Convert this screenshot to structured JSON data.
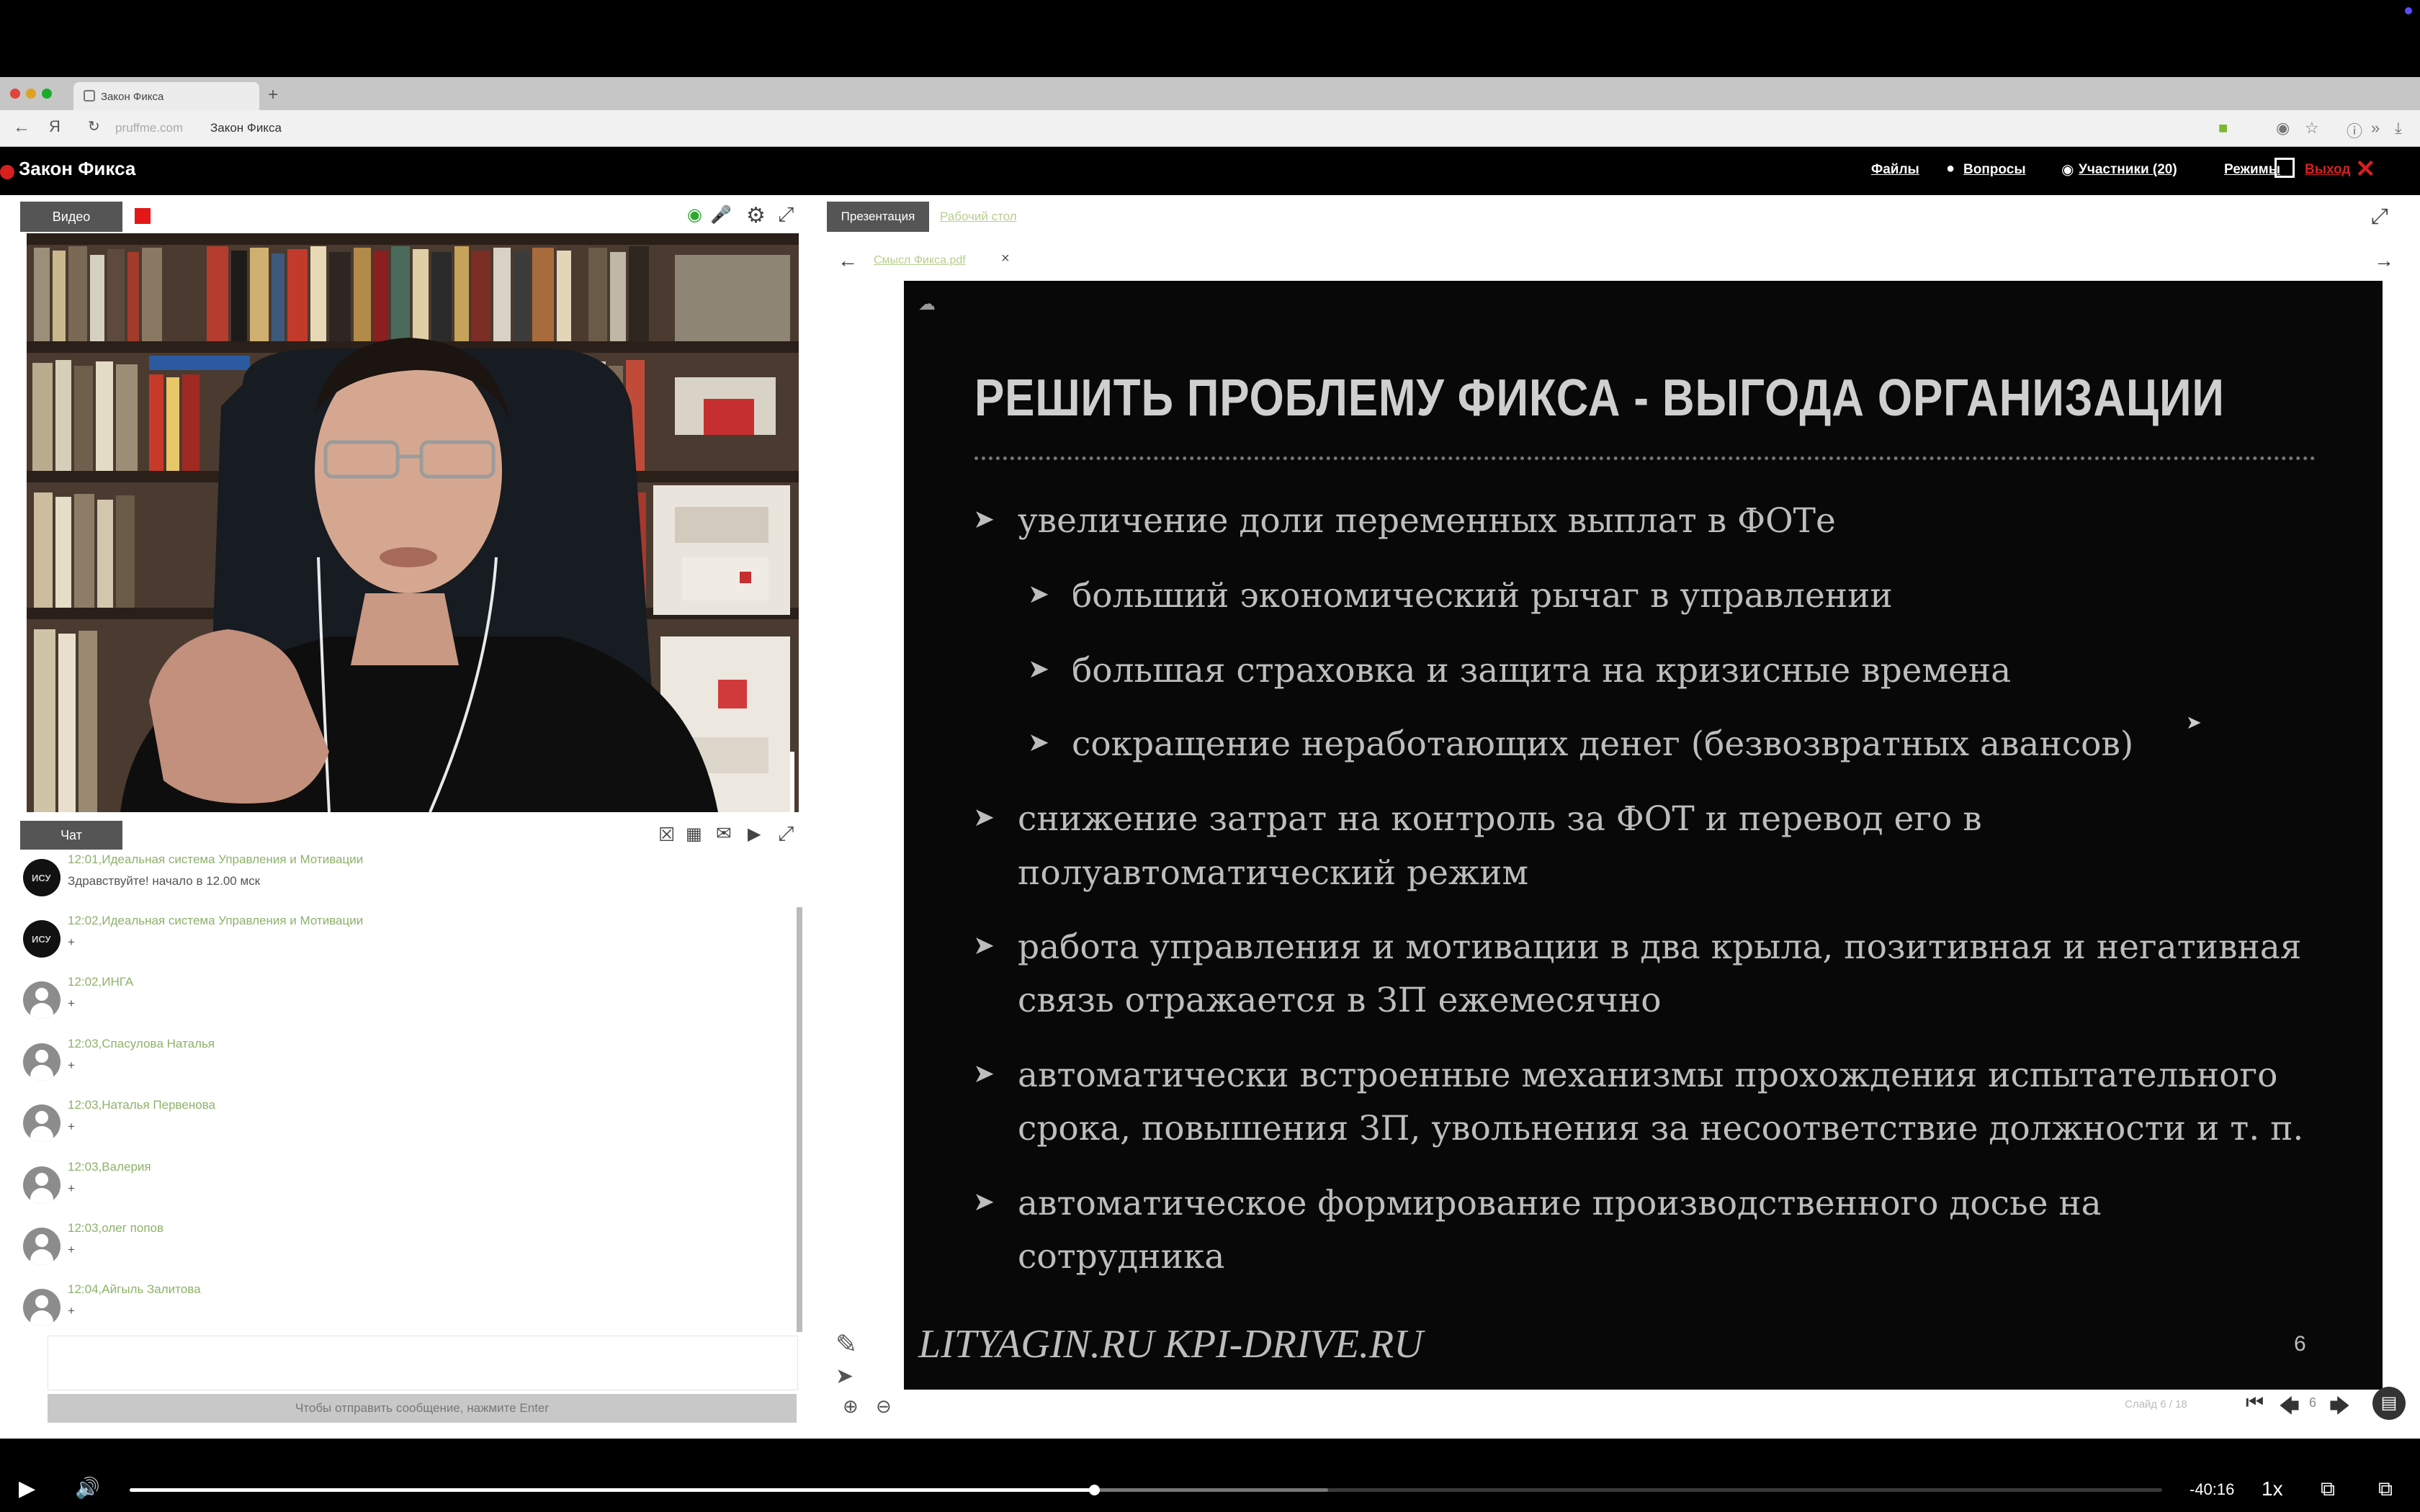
{
  "browser": {
    "tab_title": "Закон Фикса",
    "new_tab": "+",
    "url_host": "pruffme.com",
    "url_title": "Закон Фикса"
  },
  "app": {
    "title": "Закон Фикса",
    "menu": [
      "Файлы",
      "Вопросы",
      "Участники (20)",
      "Режимы",
      "Выход"
    ]
  },
  "video_panel": {
    "tab_label": "Видео"
  },
  "chat": {
    "tab_label": "Чат",
    "messages": [
      {
        "time": "12:01",
        "author": "Идеальная система Управления и Мотивации",
        "text": "Здравствуйте! начало в 12.00 мск"
      },
      {
        "time": "12:02",
        "author": "Идеальная система Управления и Мотивации",
        "text": "+"
      },
      {
        "time": "12:02",
        "author": "ИНГА",
        "text": "+"
      },
      {
        "time": "12:03",
        "author": "Спасуловa Наталья",
        "text": "+"
      },
      {
        "time": "12:03",
        "author": "Наталья Первенова",
        "text": "+"
      },
      {
        "time": "12:03",
        "author": "Валерия",
        "text": "+"
      },
      {
        "time": "12:03",
        "author": "олег попов",
        "text": "+"
      },
      {
        "time": "12:04",
        "author": "Айгыль Залитова",
        "text": "+"
      }
    ],
    "input_hint": "Чтобы отправить сообщение, нажмите Enter"
  },
  "presentation": {
    "tabs": [
      "Презентация",
      "Рабочий стол"
    ],
    "file_name": "Смысл Фикса.pdf",
    "slide": {
      "title": "РЕШИТЬ ПРОБЛЕМУ ФИКСА - ВЫГОДА ОРГАНИЗАЦИИ",
      "b1": "увеличение доли переменных выплат в ФОТе",
      "b1a": "больший экономический рычаг в управлении",
      "b1b": "большая страховка и защита на кризисные времена",
      "b1c": "сокращение неработающих денег (безвозвратных авансов)",
      "b2_l1": "снижение затрат на контроль за ФОТ и перевод его в",
      "b2_l2": "полуавтоматический режим",
      "b3_l1": "работа управления и мотивации в два крыла, позитивная и негативная",
      "b3_l2": "связь отражается в ЗП ежемесячно",
      "b4_l1": "автоматически встроенные механизмы прохождения испытательного",
      "b4_l2": "срока, повышения ЗП, увольнения за несоответствие должности и т. п.",
      "b5_l1": "автоматическое формирование производственного досье на",
      "b5_l2": "сотрудника",
      "footer": "LITYAGIN.RU  KPI-DRIVE.RU",
      "page_number": "6"
    },
    "pager": {
      "label": "Слайд 6 / 18",
      "current": "6"
    }
  },
  "player": {
    "remaining": "-40:16",
    "speed": "1x",
    "progress": 0.4746,
    "buffered": 0.5895
  }
}
